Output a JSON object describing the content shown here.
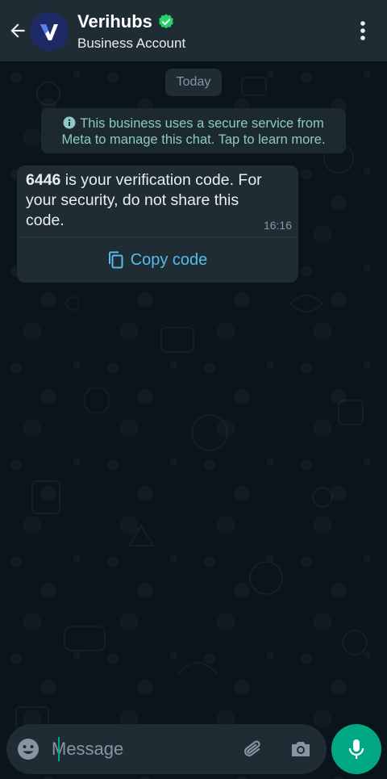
{
  "header": {
    "title": "Verihubs",
    "subtitle": "Business Account",
    "avatar_letter": "V"
  },
  "chat": {
    "date_label": "Today",
    "notice": "This business uses a secure service from Meta to manage this chat. Tap to learn more.",
    "message": {
      "code": "6446",
      "text": " is your verification code. For your security, do not share this code.",
      "time": "16:16",
      "action_label": "Copy code"
    }
  },
  "composer": {
    "placeholder": "Message"
  },
  "colors": {
    "background": "#0b141a",
    "header": "#1f2c34",
    "accent": "#00a884",
    "link": "#53bdeb",
    "notice_text": "#8cc9c3",
    "verified_badge": "#25d366"
  },
  "icons": [
    "back-arrow-icon",
    "verified-badge-icon",
    "more-vert-icon",
    "info-icon",
    "copy-icon",
    "emoji-icon",
    "attach-icon",
    "camera-icon",
    "mic-icon"
  ]
}
